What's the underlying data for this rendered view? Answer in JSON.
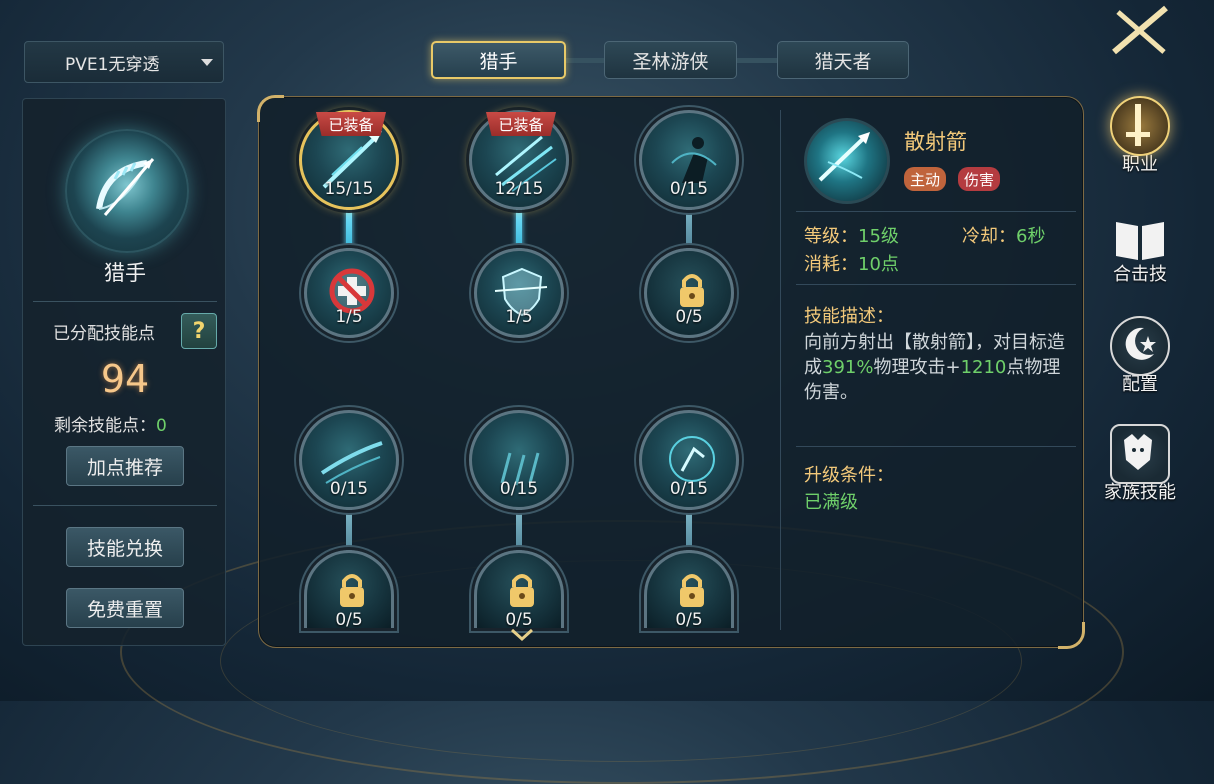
{
  "profile": {
    "label": "PVE1无穿透"
  },
  "tabs": [
    {
      "label": "猎手",
      "active": true
    },
    {
      "label": "圣林游侠",
      "active": false
    },
    {
      "label": "猎天者",
      "active": false
    }
  ],
  "left": {
    "class_name": "猎手",
    "allocated_label": "已分配技能点",
    "help": "?",
    "allocated_value": "94",
    "remaining_label": "剩余技能点：",
    "remaining_value": "0",
    "recommend_button": "加点推荐",
    "exchange_button": "技能兑换",
    "reset_button": "免费重置"
  },
  "skill_tree": {
    "equipped_badge": "已装备",
    "nodes": [
      {
        "count": "15/15",
        "equipped": true,
        "icon": "scatter-arrow-icon"
      },
      {
        "count": "12/15",
        "equipped": true,
        "icon": "multi-arrow-icon"
      },
      {
        "count": "0/15",
        "equipped": false,
        "icon": "archer-silhouette-icon"
      },
      {
        "count": "1/5",
        "equipped": false,
        "icon": "no-heal-icon"
      },
      {
        "count": "1/5",
        "equipped": false,
        "icon": "shield-arrow-icon"
      },
      {
        "count": "0/5",
        "equipped": false,
        "icon": "lock-icon"
      },
      {
        "count": "0/15",
        "equipped": false,
        "icon": "dash-arrow-icon"
      },
      {
        "count": "0/15",
        "equipped": false,
        "icon": "rain-arrow-icon"
      },
      {
        "count": "0/15",
        "equipped": false,
        "icon": "hunter-leap-icon"
      },
      {
        "count": "0/5",
        "equipped": false,
        "icon": "lock-icon"
      },
      {
        "count": "0/5",
        "equipped": false,
        "icon": "lock-icon"
      },
      {
        "count": "0/5",
        "equipped": false,
        "icon": "lock-icon"
      }
    ]
  },
  "detail": {
    "skill_name": "散射箭",
    "tags": [
      "主动",
      "伤害"
    ],
    "level_label": "等级：",
    "level_value": "15级",
    "cooldown_label": "冷却：",
    "cooldown_value": "6秒",
    "cost_label": "消耗：",
    "cost_value": "10点",
    "desc_title": "技能描述：",
    "desc_parts": [
      "向前方射出【散射箭】，对目标造成",
      "391%",
      "物理攻击+",
      "1210",
      "点物理伤害。"
    ],
    "upgrade_title": "升级条件：",
    "upgrade_value": "已满级"
  },
  "right_nav": [
    {
      "label": "职业",
      "active": true,
      "icon": "sword-icon"
    },
    {
      "label": "合击技",
      "active": false,
      "icon": "book-icon"
    },
    {
      "label": "配置",
      "active": false,
      "icon": "moon-star-icon"
    },
    {
      "label": "家族技能",
      "active": false,
      "icon": "wolf-crest-icon"
    }
  ],
  "colors": {
    "accent_gold": "#e6c35c",
    "value_green": "#6fd06a",
    "title_gold": "#f3c97a",
    "badge_red": "#c94a45"
  }
}
